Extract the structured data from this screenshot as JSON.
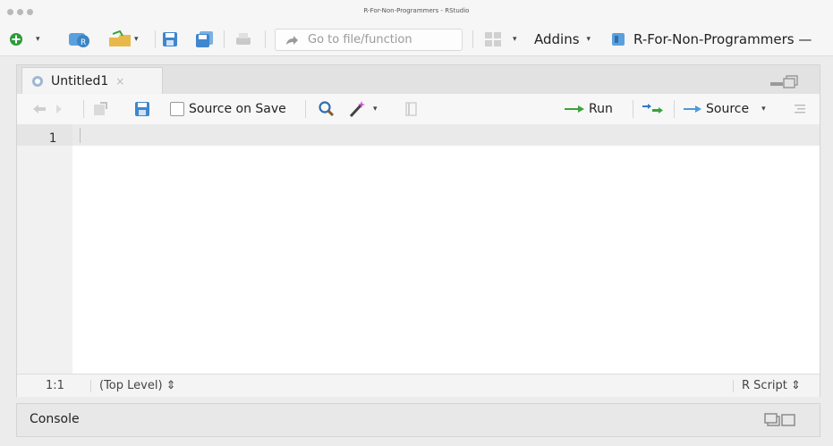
{
  "window": {
    "title": "R-For-Non-Programmers - RStudio"
  },
  "toolbar": {
    "goto_placeholder": "Go to file/function",
    "addins_label": "Addins",
    "project_label": "R-For-Non-Programmers —"
  },
  "editor": {
    "tab_label": "Untitled1",
    "tab_close": "×",
    "source_on_save_label": "Source on Save",
    "run_label": "Run",
    "source_label": "Source",
    "line_number": "1",
    "status_position": "1:1",
    "status_scope": "(Top Level) ⇕",
    "status_filetype": "R Script ⇕"
  },
  "console": {
    "label": "Console"
  },
  "colors": {
    "green_arrow": "#3aa33a",
    "blue_icon": "#2f79c9",
    "window_bg": "#ececec"
  }
}
